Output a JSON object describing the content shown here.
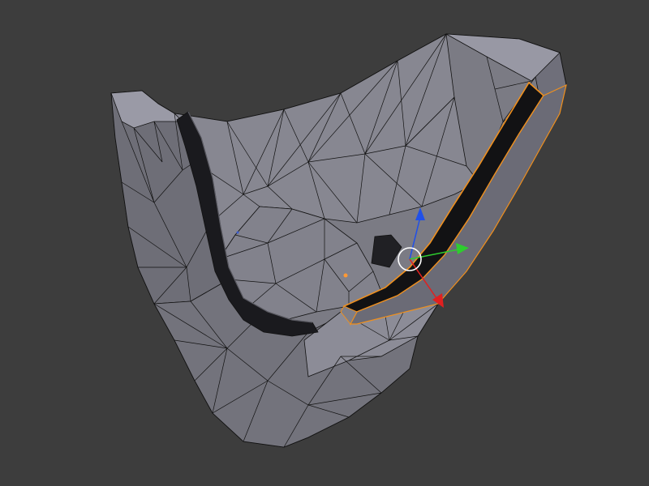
{
  "viewport": {
    "background": "#3d3d3d"
  },
  "mesh": {
    "face_color": "#7a7a82",
    "face_light": "#8e8e98",
    "face_dark": "#5e5e66",
    "wire_color": "#111111",
    "slot_color": "#141414",
    "selection_color": "#f0901e"
  },
  "gizmo": {
    "x_axis_color": "#e02020",
    "y_axis_color": "#2ecc2e",
    "z_axis_color": "#2050e8",
    "pivot_color": "#ffffff",
    "icons": [
      "translate-gizmo",
      "pivot-ring"
    ]
  },
  "origin_color": "#ff9933"
}
